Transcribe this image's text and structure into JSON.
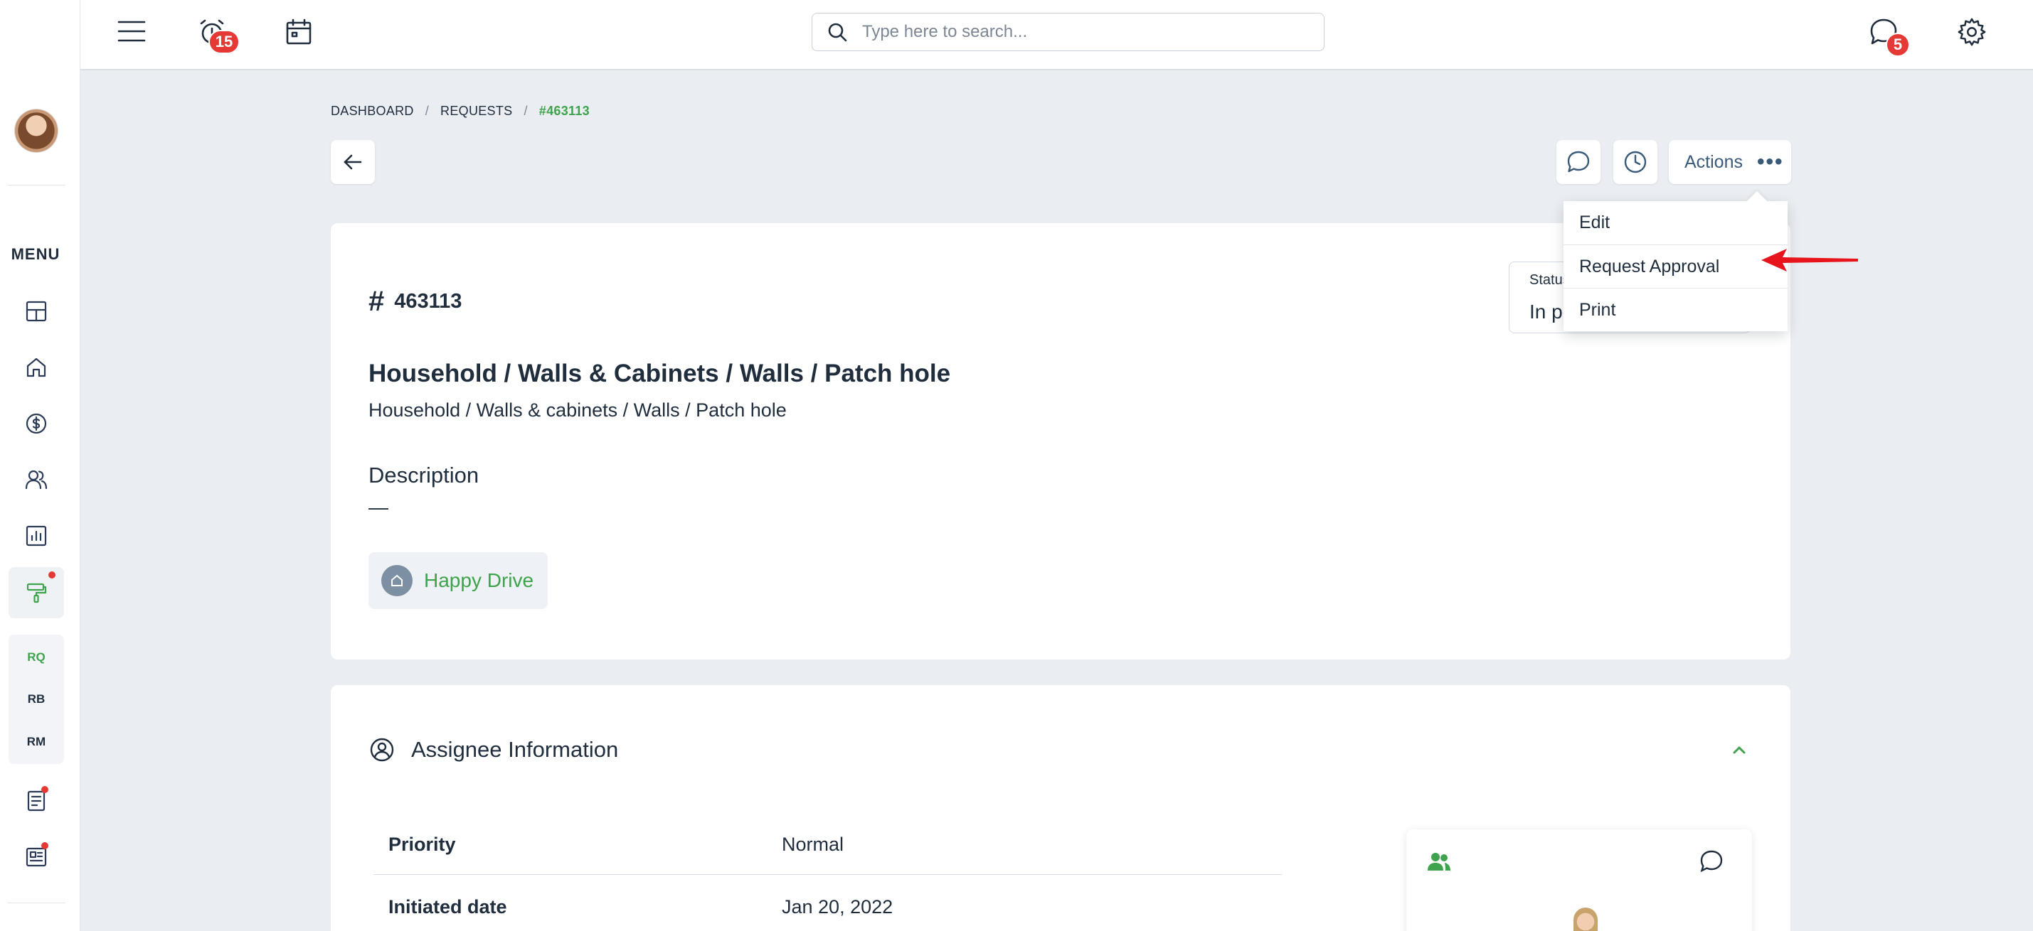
{
  "topbar": {
    "search_placeholder": "Type here to search...",
    "alarm_badge": "15",
    "chat_badge": "5"
  },
  "sidebar": {
    "menu_label": "MENU",
    "subnav": [
      "RQ",
      "RB",
      "RM"
    ]
  },
  "breadcrumb": {
    "items": [
      "DASHBOARD",
      "REQUESTS",
      "#463113"
    ],
    "separator": "/"
  },
  "toolbar": {
    "actions_label": "Actions",
    "actions_dots": "•••"
  },
  "dropdown": {
    "options": [
      "Edit",
      "Request Approval",
      "Print"
    ]
  },
  "request": {
    "hash": "#",
    "id": "463113",
    "title": "Household / Walls & Cabinets / Walls / Patch hole",
    "subtitle": "Household / Walls & cabinets / Walls / Patch hole",
    "description_label": "Description",
    "description_value": "—",
    "property_chip": "Happy Drive",
    "status_label": "Status",
    "status_value": "In progress"
  },
  "assignee": {
    "title": "Assignee Information",
    "rows": [
      {
        "key": "Priority",
        "value": "Normal"
      },
      {
        "key": "Initiated date",
        "value": "Jan 20, 2022"
      }
    ]
  },
  "colors": {
    "accent_green": "#3fa34d",
    "badge_red": "#e53935",
    "text_dark": "#1f2d3d",
    "page_bg": "#eaedf1"
  }
}
